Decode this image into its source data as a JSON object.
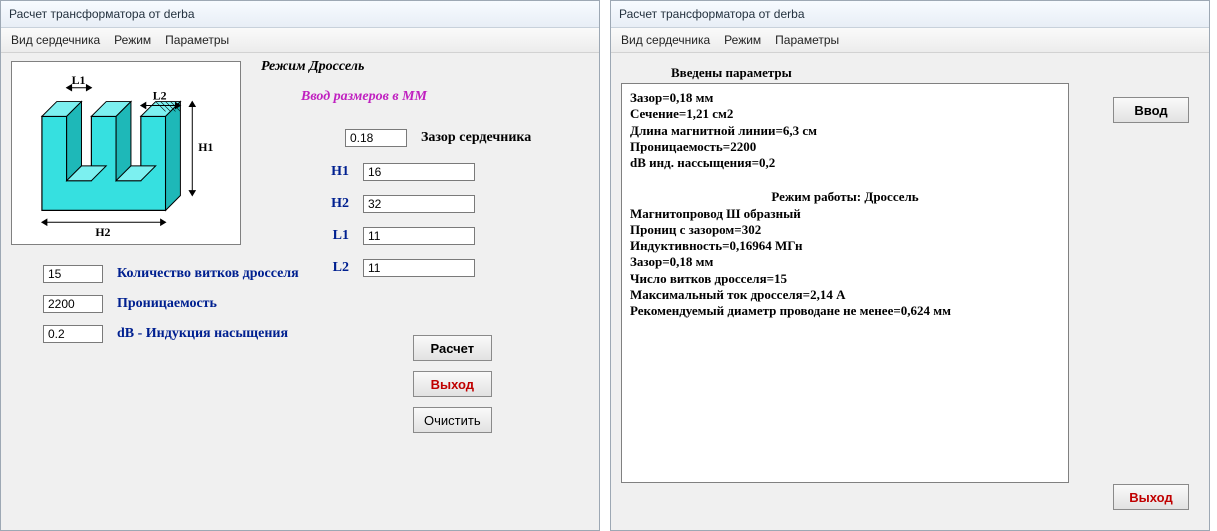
{
  "left": {
    "title": "Расчет трансформатора от derba",
    "menu": {
      "core": "Вид сердечника",
      "mode": "Режим",
      "params": "Параметры"
    },
    "mode_heading": "Режим Дроссель",
    "mm_heading": "Ввод размеров в ММ",
    "gap": {
      "value": "0.18",
      "label": "Зазор сердечника"
    },
    "h1": {
      "label": "H1",
      "value": "16"
    },
    "h2": {
      "label": "H2",
      "value": "32"
    },
    "l1": {
      "label": "L1",
      "value": "11"
    },
    "l2": {
      "label": "L2",
      "value": "11"
    },
    "turns": {
      "value": "15",
      "label": "Количество витков дросселя"
    },
    "perm": {
      "value": "2200",
      "label": "Проницаемость"
    },
    "db": {
      "value": "0.2",
      "label": "dВ - Индукция насыщения"
    },
    "buttons": {
      "calc": "Расчет",
      "exit": "Выход",
      "clear": "Очистить"
    },
    "svg_labels": {
      "l1": "L1",
      "l2": "L2",
      "h1": "H1",
      "h2": "H2"
    }
  },
  "right": {
    "title": "Расчет трансформатора от derba",
    "menu": {
      "core": "Вид сердечника",
      "mode": "Режим",
      "params": "Параметры"
    },
    "heading": "Введены параметры",
    "top_lines": [
      "Зазор=0,18 мм",
      "Сечение=1,21 см2",
      "Длина магнитной линии=6,3 см",
      "Проницаемость=2200",
      "dВ инд. нассыщения=0,2"
    ],
    "mode_line": "Режим работы: Дроссель",
    "bottom_lines": [
      "Магнитопровод Ш образный",
      "Прониц с зазором=302",
      "Индуктивность=0,16964 МГн",
      "Зазор=0,18 мм",
      "Число витков дросселя=15",
      "Максимальный ток дросселя=2,14 А",
      "Рекомендуемый диаметр проводане не менее=0,624 мм"
    ],
    "buttons": {
      "input": "Ввод",
      "exit": "Выход"
    }
  }
}
